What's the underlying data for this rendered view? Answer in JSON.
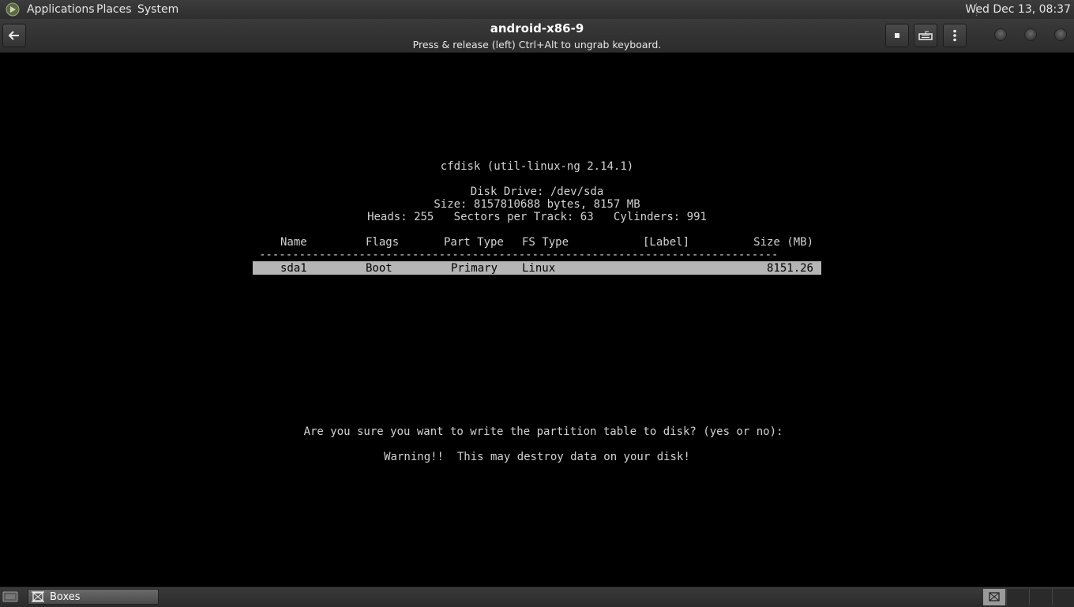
{
  "top_panel": {
    "menus": [
      "Applications",
      "Places",
      "System"
    ],
    "clock": "Wed Dec 13, 08:37"
  },
  "header": {
    "title": "android-x86-9",
    "subtitle": "Press & release (left) Ctrl+Alt to ungrab keyboard."
  },
  "terminal": {
    "program": "cfdisk (util-linux-ng 2.14.1)",
    "disk_drive": "Disk Drive: /dev/sda",
    "size_line": "Size: 8157810688 bytes, 8157 MB",
    "geometry": "Heads: 255   Sectors per Track: 63   Cylinders: 991",
    "columns": [
      "Name",
      "Flags",
      "Part Type",
      "FS Type",
      "[Label]",
      "Size (MB)"
    ],
    "separator": "------------------------------------------------------------------------------",
    "rows": [
      {
        "name": "sda1",
        "flags": "Boot",
        "part_type": "Primary",
        "fs_type": "Linux",
        "label": "",
        "size": "8151.26"
      }
    ],
    "prompt": "Are you sure you want to write the partition table to disk? (yes or no):",
    "warning": "Warning!!  This may destroy data on your disk!"
  },
  "bottom_panel": {
    "task": "Boxes"
  }
}
